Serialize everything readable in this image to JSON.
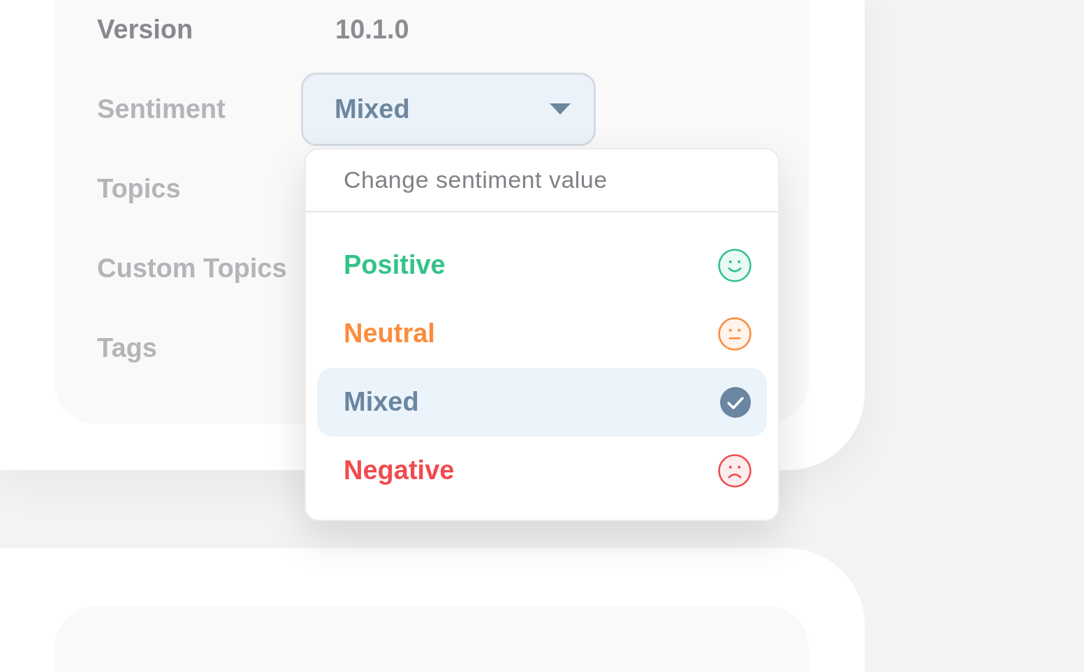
{
  "fields": [
    {
      "label": "Version",
      "kind": "text",
      "value": "10.1.0"
    },
    {
      "label": "Sentiment",
      "kind": "dropdown",
      "value": "Mixed",
      "expanded": true
    },
    {
      "label": "Topics",
      "kind": "empty"
    },
    {
      "label": "Custom Topics",
      "kind": "empty"
    },
    {
      "label": "Tags",
      "kind": "empty"
    }
  ],
  "sentiment_menu": {
    "title": "Change sentiment value",
    "options": [
      {
        "label": "Positive",
        "kind": "positive",
        "color": "#34c28a",
        "selected": false
      },
      {
        "label": "Neutral",
        "kind": "neutral",
        "color": "#fb8c3c",
        "selected": false
      },
      {
        "label": "Mixed",
        "kind": "mixed",
        "color": "#6a86a0",
        "selected": true
      },
      {
        "label": "Negative",
        "kind": "negative",
        "color": "#f04b4f",
        "selected": false
      }
    ]
  }
}
